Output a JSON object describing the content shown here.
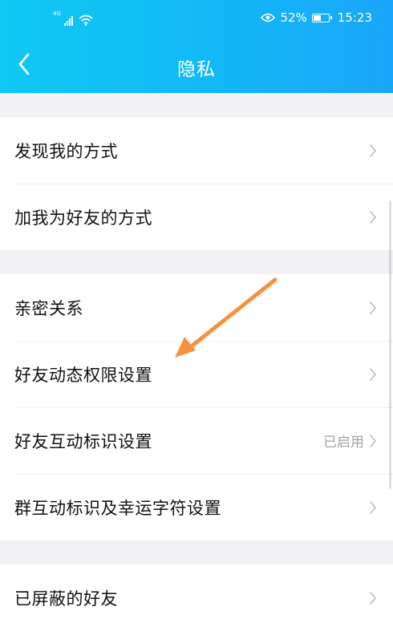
{
  "status_bar": {
    "network": "4G",
    "battery": "52%",
    "battery_level": 0.52,
    "time": "15:23"
  },
  "nav": {
    "title": "隐私",
    "back_icon": "chevron-left-icon"
  },
  "sections": [
    [
      {
        "label": "发现我的方式",
        "value": ""
      },
      {
        "label": "加我为好友的方式",
        "value": ""
      }
    ],
    [
      {
        "label": "亲密关系",
        "value": ""
      },
      {
        "label": "好友动态权限设置",
        "value": ""
      },
      {
        "label": "好友互动标识设置",
        "value": "已启用"
      },
      {
        "label": "群互动标识及幸运字符设置",
        "value": ""
      }
    ],
    [
      {
        "label": "已屏蔽的好友",
        "value": ""
      }
    ]
  ],
  "annotation": {
    "color": "#f5923e"
  },
  "colors": {
    "header_start": "#10c8f4",
    "header_end": "#1aa6f8",
    "page_bg": "#f2f2f5",
    "value_text": "#a3a3a8"
  }
}
